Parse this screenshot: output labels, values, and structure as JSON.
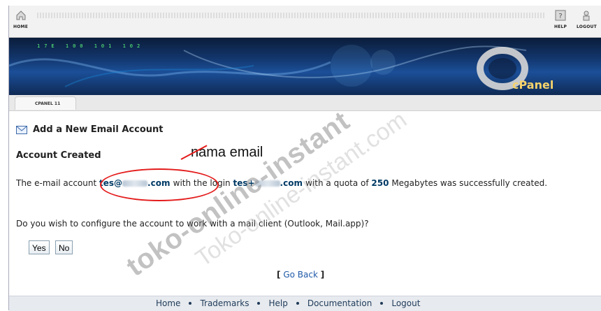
{
  "topbar": {
    "home_label": "HOME",
    "help_label": "HELP",
    "logout_label": "LOGOUT",
    "icons": {
      "home": "home-icon",
      "help": "help-icon",
      "logout": "logout-icon"
    }
  },
  "banner": {
    "logo_text": "cPanel",
    "lights_text": "17E 100 101 102"
  },
  "tabstrip": {
    "active_tab": "CPANEL 11"
  },
  "page": {
    "title": "Add a New Email Account",
    "subtitle": "Account Created",
    "message": {
      "part1": "The e-mail account ",
      "email_prefix": "tes@",
      "email_suffix": ".com",
      "part2": " with the login ",
      "login_prefix": "tes+",
      "login_suffix": ".com",
      "part3": " with a quota of ",
      "quota": "250",
      "part4": " Megabytes was successfully created."
    },
    "question": "Do you wish to configure the account to work with a mail client (Outlook, Mail.app)?",
    "buttons": {
      "yes": "Yes",
      "no": "No"
    },
    "go_back": "Go Back",
    "bracket_open": "[",
    "bracket_close": "]"
  },
  "annotation": {
    "note": "nama email",
    "accent": "#e41b1b"
  },
  "watermark": {
    "main": "toko-online-instant",
    "secondary": "Toko-online-instant.com"
  },
  "footer": {
    "links": [
      "Home",
      "Trademarks",
      "Help",
      "Documentation",
      "Logout"
    ]
  }
}
